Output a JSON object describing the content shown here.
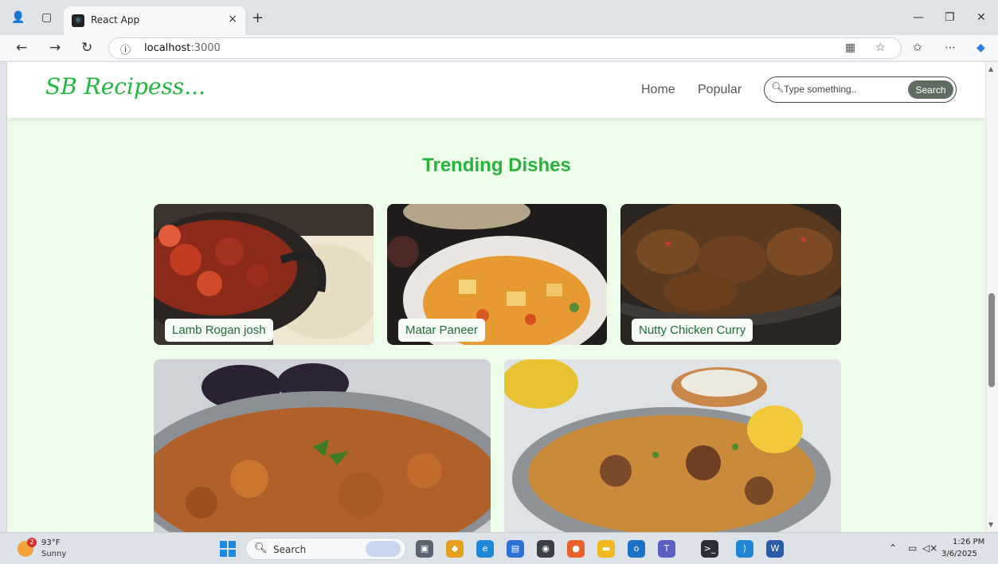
{
  "browser": {
    "tab_title": "React App",
    "tab_close": "×",
    "new_tab": "+",
    "address_host": "localhost",
    "address_port": ":3000",
    "info_icon": "ⓘ"
  },
  "site": {
    "logo": "SB Recipess...",
    "nav": {
      "home": "Home",
      "popular": "Popular"
    },
    "search": {
      "placeholder": "Type something..",
      "button": "Search"
    },
    "section_title": "Trending Dishes",
    "dishes": [
      {
        "name": "Lamb Rogan josh"
      },
      {
        "name": "Matar Paneer"
      },
      {
        "name": "Nutty Chicken Curry"
      }
    ]
  },
  "taskbar": {
    "weather_temp": "93°F",
    "weather_condition": "Sunny",
    "weather_badge": "2",
    "search_label": "Search",
    "time": "1:26 PM",
    "date": "3/6/2025"
  },
  "colors": {
    "page_background": "#edfde9",
    "brand_green": "#1fb83c",
    "search_button": "#5f6d61"
  }
}
